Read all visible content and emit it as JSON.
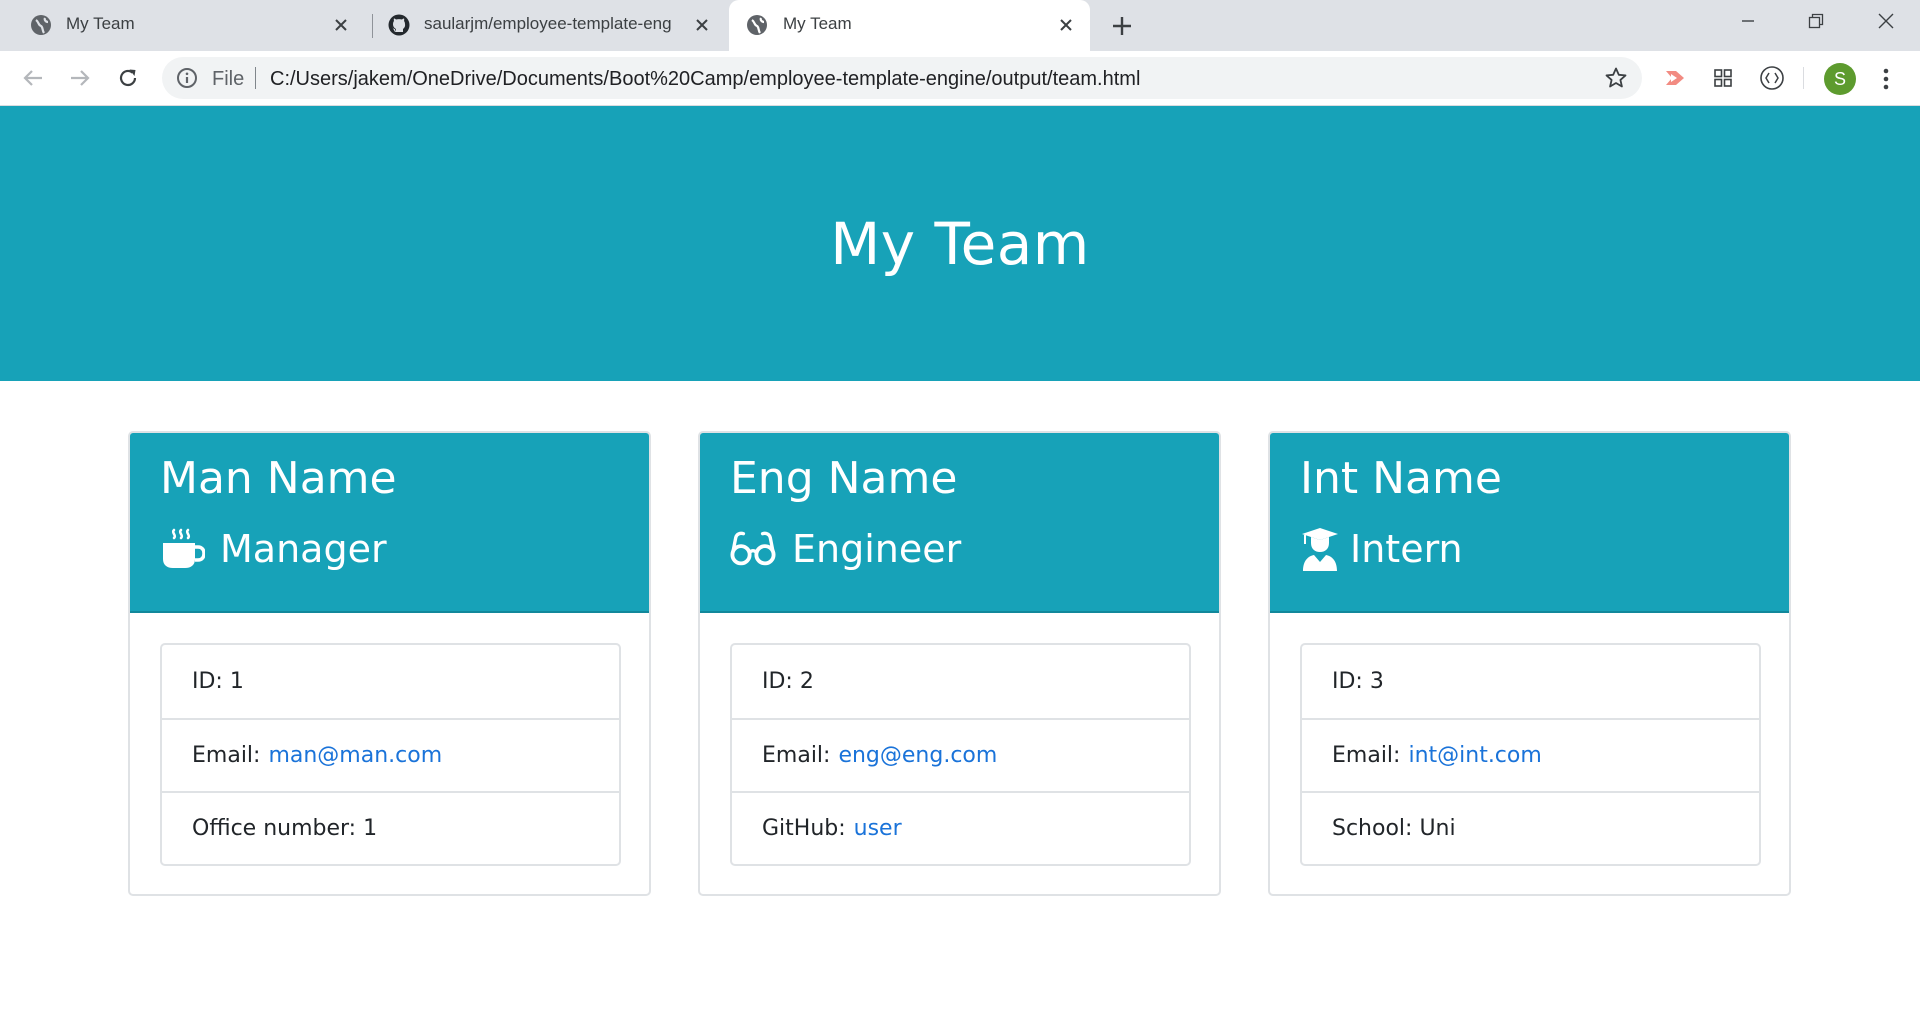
{
  "browser": {
    "tabs": [
      {
        "title": "My Team",
        "active": false,
        "icon": "globe-icon"
      },
      {
        "title": "saularjm/employee-template-eng",
        "active": false,
        "icon": "github-icon"
      },
      {
        "title": "My Team",
        "active": true,
        "icon": "globe-icon"
      }
    ],
    "address": {
      "scheme_label": "File",
      "url": "C:/Users/jakem/OneDrive/Documents/Boot%20Camp/employee-template-engine/output/team.html"
    },
    "profile_initial": "S",
    "colors": {
      "profile": "#5d9b2e",
      "tabstrip": "#dee1e6"
    }
  },
  "page": {
    "title": "My Team",
    "accent_color": "#17a2b8",
    "link_color": "#1a73d9",
    "cards": [
      {
        "name": "Man Name",
        "role": "Manager",
        "role_icon": "coffee-mug-icon",
        "id_label": "ID: 1",
        "email_label": "Email:",
        "email": "man@man.com",
        "extra_label": "Office number: 1",
        "extra_link": ""
      },
      {
        "name": "Eng Name",
        "role": "Engineer",
        "role_icon": "glasses-icon",
        "id_label": "ID: 2",
        "email_label": "Email:",
        "email": "eng@eng.com",
        "extra_label": "GitHub:",
        "extra_link": "user"
      },
      {
        "name": "Int Name",
        "role": "Intern",
        "role_icon": "graduate-icon",
        "id_label": "ID: 3",
        "email_label": "Email:",
        "email": "int@int.com",
        "extra_label": "School: Uni",
        "extra_link": ""
      }
    ]
  }
}
